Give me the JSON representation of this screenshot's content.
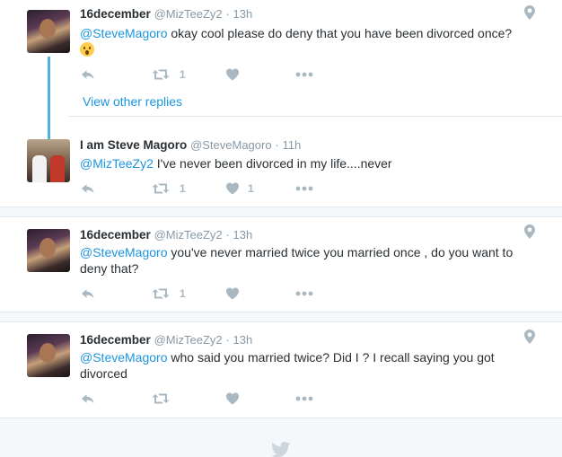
{
  "colors": {
    "link": "#1b95e0",
    "muted": "#8899a6",
    "action": "#aab8c2",
    "thread_line": "#52b3d9"
  },
  "tweets": [
    {
      "name": "16december",
      "handle": "@MizTeeZy2",
      "time": "13h",
      "mention": "@SteveMagoro",
      "text": " okay cool please do deny that you have been divorced once?",
      "emoji": "astonished-face-emoji",
      "retweets": "1",
      "likes": ""
    },
    {
      "name": "I am Steve Magoro",
      "handle": "@SteveMagoro",
      "time": "11h",
      "mention": "@MizTeeZy2",
      "text": " I've never been divorced in my life....never",
      "retweets": "1",
      "likes": "1"
    },
    {
      "name": "16december",
      "handle": "@MizTeeZy2",
      "time": "13h",
      "mention": "@SteveMagoro",
      "text": " you've never married twice you married once , do you want to deny that?",
      "retweets": "1",
      "likes": ""
    },
    {
      "name": "16december",
      "handle": "@MizTeeZy2",
      "time": "13h",
      "mention": "@SteveMagoro",
      "text": " who said you married twice? Did I  ? I recall saying you got divorced",
      "retweets": "",
      "likes": ""
    }
  ],
  "view_other_replies": "View other replies",
  "separator": "·"
}
